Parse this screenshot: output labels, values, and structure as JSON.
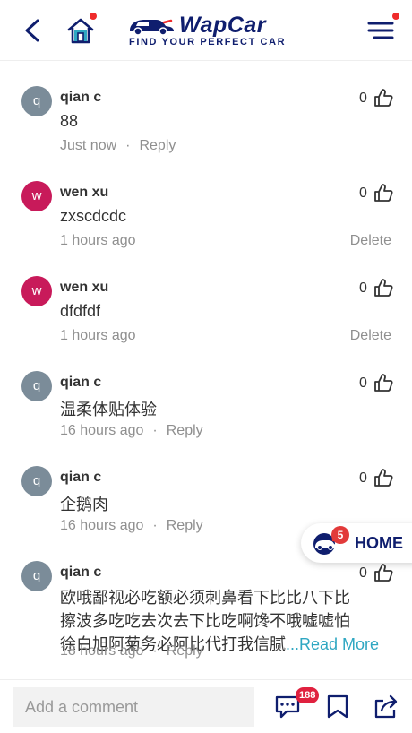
{
  "header": {
    "logo_text": "WapCar",
    "logo_tagline": "FIND YOUR PERFECT CAR"
  },
  "comments": [
    {
      "author": "qian c",
      "avatar_letter": "q",
      "avatar_color": "#7b8c99",
      "text": "88",
      "time": "Just now",
      "action": "Reply",
      "likes": "0"
    },
    {
      "author": "wen xu",
      "avatar_letter": "w",
      "avatar_color": "#c81a5a",
      "text": "zxscdcdc",
      "time": "1 hours ago",
      "action": "Delete",
      "likes": "0"
    },
    {
      "author": "wen xu",
      "avatar_letter": "w",
      "avatar_color": "#c81a5a",
      "text": "dfdfdf",
      "time": "1 hours ago",
      "action": "Delete",
      "likes": "0"
    },
    {
      "author": "qian c",
      "avatar_letter": "q",
      "avatar_color": "#7b8c99",
      "text": "温柔体贴体验",
      "time": "16 hours ago",
      "action": "Reply",
      "likes": "0"
    },
    {
      "author": "qian c",
      "avatar_letter": "q",
      "avatar_color": "#7b8c99",
      "text": "企鹅肉",
      "time": "16 hours ago",
      "action": "Reply",
      "likes": "0"
    },
    {
      "author": "qian c",
      "avatar_letter": "q",
      "avatar_color": "#7b8c99",
      "text_lines": [
        "欧哦鄙视必吃额必须刺鼻看下比比八下比",
        "擦波多吃吃去次去下比吃啊馋不哦嘘嘘怕",
        "徐白旭阿菊务必阿比代打我信腻"
      ],
      "read_more": "...Read More",
      "time": "18 hours ago",
      "action": "Reply",
      "likes": "0"
    }
  ],
  "separator": "·",
  "float_home": {
    "label": "HOME",
    "badge": "5"
  },
  "bottom_bar": {
    "input_placeholder": "Add a comment",
    "comment_count": "188"
  },
  "colors": {
    "brand_navy": "#0f1e6e",
    "notification_red": "#ef2b2b",
    "read_more": "#2fa7c2"
  }
}
